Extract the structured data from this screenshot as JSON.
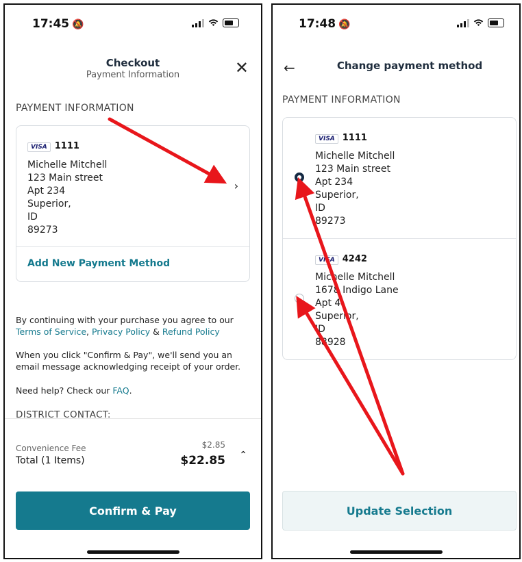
{
  "left_screen": {
    "status": {
      "time": "17:45"
    },
    "header": {
      "title": "Checkout",
      "subtitle": "Payment Information"
    },
    "section_label": "PAYMENT INFORMATION",
    "payment_card": {
      "brand": "VISA",
      "last4": "1111",
      "address_lines": [
        "Michelle Mitchell",
        "123 Main street",
        "Apt 234",
        "Superior,",
        "ID",
        "89273"
      ]
    },
    "add_payment_label": "Add New Payment Method",
    "legal": {
      "p1_prefix": "By continuing with your purchase you agree to our",
      "terms": "Terms of Service",
      "privacy": "Privacy Policy",
      "refund": "Refund Policy",
      "p2": "When you click \"Confirm & Pay\", we'll send you an email message acknowledging receipt of your order.",
      "help_prefix": "Need help? Check our",
      "faq": "FAQ",
      "district_contact": "DISTRICT CONTACT:"
    },
    "summary": {
      "fee_label": "Convenience Fee",
      "fee_amount": "$2.85",
      "total_label": "Total (1 Items)",
      "total_amount": "$22.85"
    },
    "confirm_button": "Confirm & Pay"
  },
  "right_screen": {
    "status": {
      "time": "17:48"
    },
    "header": {
      "title": "Change payment method"
    },
    "section_label": "PAYMENT INFORMATION",
    "methods": [
      {
        "brand": "VISA",
        "last4": "1111",
        "selected": true,
        "address_lines": [
          "Michelle Mitchell",
          "123 Main street",
          "Apt 234",
          "Superior,",
          "ID",
          "89273"
        ]
      },
      {
        "brand": "VISA",
        "last4": "4242",
        "selected": false,
        "address_lines": [
          "Michelle Mitchell",
          "1678 Indigo Lane",
          "Apt 4",
          "Superior,",
          "ID",
          "88928"
        ]
      }
    ],
    "update_button": "Update Selection"
  },
  "annotation_color": "#e8161b"
}
